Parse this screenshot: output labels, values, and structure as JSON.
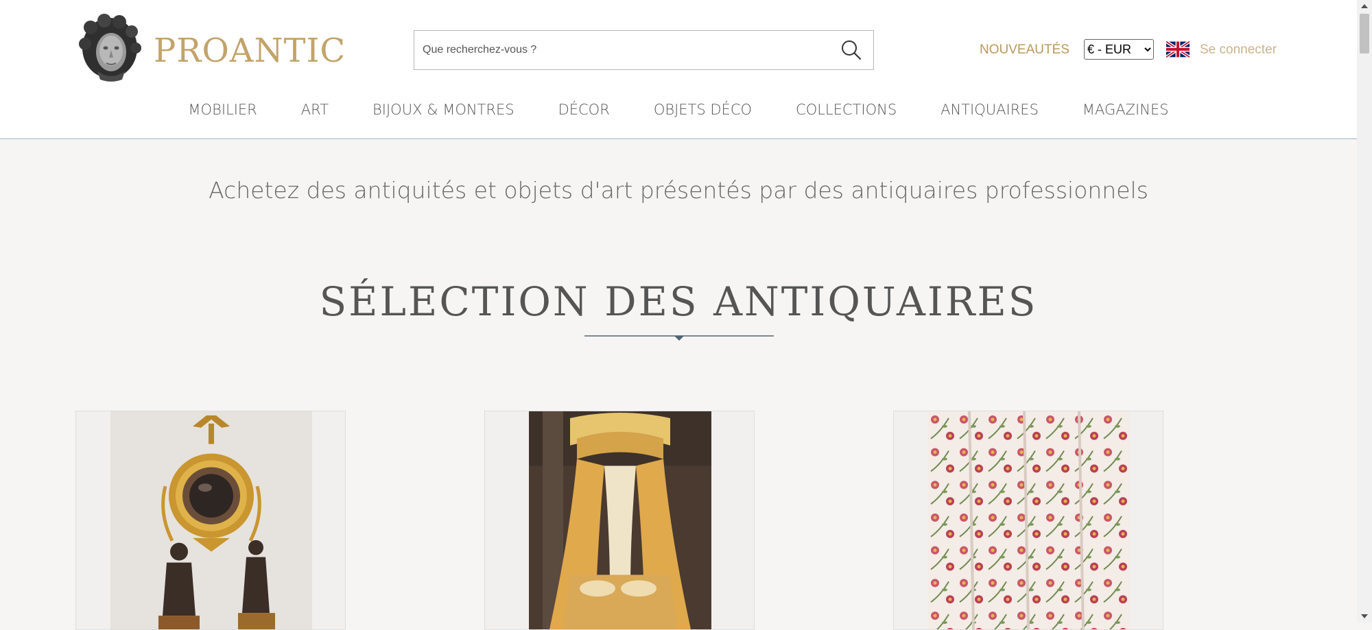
{
  "header": {
    "logo_text": "PROANTIC",
    "search": {
      "placeholder": "Que recherchez-vous ?",
      "value": ""
    },
    "nouveautes_label": "NOUVEAUTÉS",
    "currency": {
      "selected": "€ - EUR"
    },
    "login_label": "Se connecter",
    "brand_color": "#c2a36a"
  },
  "nav": {
    "items": [
      {
        "label": "MOBILIER"
      },
      {
        "label": "ART"
      },
      {
        "label": "BIJOUX & MONTRES"
      },
      {
        "label": "DÉCOR"
      },
      {
        "label": "OBJETS DÉCO"
      },
      {
        "label": "COLLECTIONS"
      },
      {
        "label": "ANTIQUAIRES"
      },
      {
        "label": "MAGAZINES"
      }
    ]
  },
  "main": {
    "tagline": "Achetez des antiquités et objets d'art présentés par des antiquaires professionnels",
    "section_title": "SÉLECTION DES ANTIQUAIRES",
    "cards": [
      {
        "image": "mirror-and-bronzes-photo"
      },
      {
        "image": "canopy-bed-photo"
      },
      {
        "image": "floral-curtain-photo"
      }
    ]
  }
}
